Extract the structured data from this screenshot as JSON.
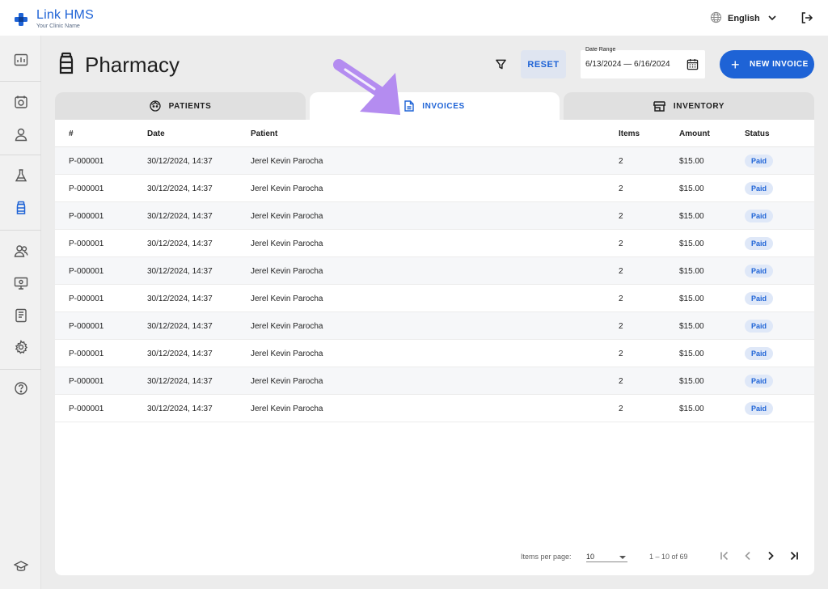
{
  "app": {
    "name": "Link HMS",
    "subtitle": "Your Clinic Name"
  },
  "header": {
    "language": "English",
    "icons": [
      "globe-icon",
      "chevron-down-icon",
      "logout-icon"
    ]
  },
  "sidebar": {
    "items": [
      {
        "icon": "dashboard-icon",
        "active": false
      },
      {
        "icon": "appointments-icon",
        "active": false
      },
      {
        "icon": "user-icon",
        "active": false
      },
      {
        "icon": "lab-flask-icon",
        "active": false
      },
      {
        "icon": "pharmacy-bottle-icon",
        "active": true
      },
      {
        "icon": "staff-icon",
        "active": false
      },
      {
        "icon": "monitor-icon",
        "active": false
      },
      {
        "icon": "reports-icon",
        "active": false
      },
      {
        "icon": "settings-icon",
        "active": false
      },
      {
        "icon": "help-icon",
        "active": false
      },
      {
        "icon": "graduation-cap-icon",
        "active": false
      }
    ]
  },
  "page": {
    "title": "Pharmacy",
    "reset_label": "RESET",
    "date_range_label": "Date Range",
    "date_range_value": "6/13/2024 — 6/16/2024",
    "new_invoice_label": "NEW INVOICE",
    "plus": "+"
  },
  "tabs": [
    {
      "label": "PATIENTS",
      "icon": "face-icon",
      "active": false
    },
    {
      "label": "INVOICES",
      "icon": "document-icon",
      "active": true
    },
    {
      "label": "INVENTORY",
      "icon": "store-icon",
      "active": false
    }
  ],
  "table": {
    "columns": [
      "#",
      "Date",
      "Patient",
      "Items",
      "Amount",
      "Status"
    ],
    "rows": [
      {
        "id": "P-000001",
        "date": "30/12/2024, 14:37",
        "patient": "Jerel Kevin Parocha",
        "items": "2",
        "amount": "$15.00",
        "status": "Paid"
      },
      {
        "id": "P-000001",
        "date": "30/12/2024, 14:37",
        "patient": "Jerel Kevin Parocha",
        "items": "2",
        "amount": "$15.00",
        "status": "Paid"
      },
      {
        "id": "P-000001",
        "date": "30/12/2024, 14:37",
        "patient": "Jerel Kevin Parocha",
        "items": "2",
        "amount": "$15.00",
        "status": "Paid"
      },
      {
        "id": "P-000001",
        "date": "30/12/2024, 14:37",
        "patient": "Jerel Kevin Parocha",
        "items": "2",
        "amount": "$15.00",
        "status": "Paid"
      },
      {
        "id": "P-000001",
        "date": "30/12/2024, 14:37",
        "patient": "Jerel Kevin Parocha",
        "items": "2",
        "amount": "$15.00",
        "status": "Paid"
      },
      {
        "id": "P-000001",
        "date": "30/12/2024, 14:37",
        "patient": "Jerel Kevin Parocha",
        "items": "2",
        "amount": "$15.00",
        "status": "Paid"
      },
      {
        "id": "P-000001",
        "date": "30/12/2024, 14:37",
        "patient": "Jerel Kevin Parocha",
        "items": "2",
        "amount": "$15.00",
        "status": "Paid"
      },
      {
        "id": "P-000001",
        "date": "30/12/2024, 14:37",
        "patient": "Jerel Kevin Parocha",
        "items": "2",
        "amount": "$15.00",
        "status": "Paid"
      },
      {
        "id": "P-000001",
        "date": "30/12/2024, 14:37",
        "patient": "Jerel Kevin Parocha",
        "items": "2",
        "amount": "$15.00",
        "status": "Paid"
      },
      {
        "id": "P-000001",
        "date": "30/12/2024, 14:37",
        "patient": "Jerel Kevin Parocha",
        "items": "2",
        "amount": "$15.00",
        "status": "Paid"
      }
    ]
  },
  "pagination": {
    "items_per_page_label": "Items per page:",
    "items_per_page_value": "10",
    "range_text": "1 – 10 of 69",
    "icons": [
      "first-page-icon",
      "previous-page-icon",
      "next-page-icon",
      "last-page-icon"
    ]
  },
  "colors": {
    "primary": "#1e63d6",
    "highlight_arrow": "#b48cf0",
    "badge_bg": "#dfe8f8"
  }
}
